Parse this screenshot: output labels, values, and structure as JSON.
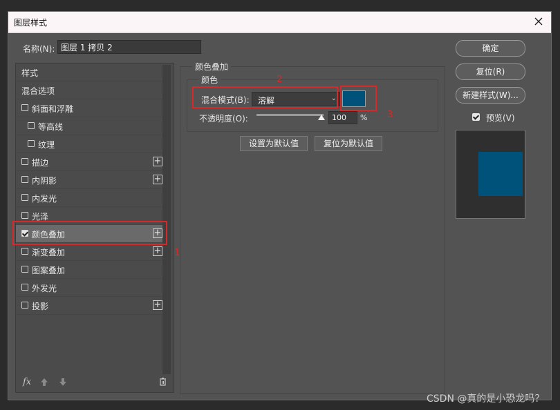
{
  "window": {
    "title": "图层样式",
    "close_icon": "close-icon"
  },
  "name_field": {
    "label": "名称(N):",
    "value": "图层 1 拷贝 2"
  },
  "left_list": {
    "items": [
      {
        "label": "样式",
        "checkbox": false,
        "checked": false,
        "plus": false,
        "indent": 0
      },
      {
        "label": "混合选项",
        "checkbox": false,
        "checked": false,
        "plus": false,
        "indent": 0
      },
      {
        "label": "斜面和浮雕",
        "checkbox": true,
        "checked": false,
        "plus": false,
        "indent": 0
      },
      {
        "label": "等高线",
        "checkbox": true,
        "checked": false,
        "plus": false,
        "indent": 1
      },
      {
        "label": "纹理",
        "checkbox": true,
        "checked": false,
        "plus": false,
        "indent": 1
      },
      {
        "label": "描边",
        "checkbox": true,
        "checked": false,
        "plus": true,
        "indent": 0
      },
      {
        "label": "内阴影",
        "checkbox": true,
        "checked": false,
        "plus": true,
        "indent": 0
      },
      {
        "label": "内发光",
        "checkbox": true,
        "checked": false,
        "plus": false,
        "indent": 0
      },
      {
        "label": "光泽",
        "checkbox": true,
        "checked": false,
        "plus": false,
        "indent": 0
      },
      {
        "label": "颜色叠加",
        "checkbox": true,
        "checked": true,
        "plus": true,
        "indent": 0,
        "selected": true
      },
      {
        "label": "渐变叠加",
        "checkbox": true,
        "checked": false,
        "plus": true,
        "indent": 0
      },
      {
        "label": "图案叠加",
        "checkbox": true,
        "checked": false,
        "plus": false,
        "indent": 0
      },
      {
        "label": "外发光",
        "checkbox": true,
        "checked": false,
        "plus": false,
        "indent": 0
      },
      {
        "label": "投影",
        "checkbox": true,
        "checked": false,
        "plus": true,
        "indent": 0
      }
    ],
    "tools": {
      "fx": "fx",
      "up_icon": "arrow-up-icon",
      "down_icon": "arrow-down-icon",
      "trash_icon": "trash-icon"
    }
  },
  "panel": {
    "title": "颜色叠加",
    "group_title": "颜色",
    "blend_mode_label": "混合模式(B):",
    "blend_mode_value": "溶解",
    "color": "#00527a",
    "opacity_label": "不透明度(O):",
    "opacity_value": "100",
    "opacity_unit": "%",
    "opacity_fraction": 1.0,
    "set_default_button": "设置为默认值",
    "reset_default_button": "复位为默认值"
  },
  "annotations": {
    "n1": "1",
    "n2": "2",
    "n3": "3",
    "color": "#d62a2a"
  },
  "right": {
    "ok_button": "确定",
    "reset_button": "复位(R)",
    "new_style_button": "新建样式(W)...",
    "preview_label": "预览(V)",
    "preview_checked": true
  },
  "watermark": "CSDN @真的是小恐龙吗？"
}
